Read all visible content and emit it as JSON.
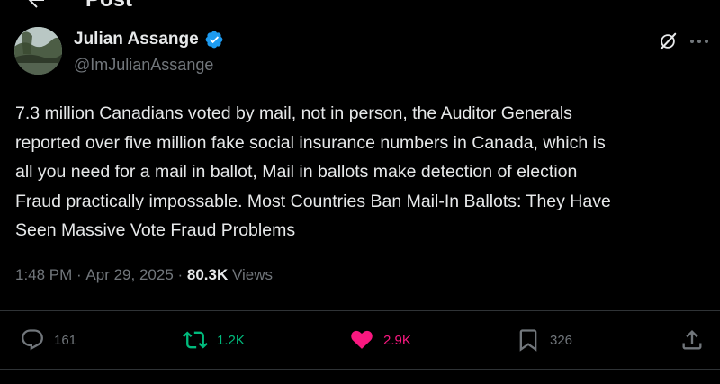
{
  "header": {
    "title": "Post",
    "back_icon": "back-arrow-icon"
  },
  "author": {
    "name": "Julian Assange",
    "handle": "@ImJulianAssange",
    "verified_icon": "verified-badge-icon",
    "verified_color": "#1d9bf0"
  },
  "tweet": {
    "text": "7.3 million Canadians voted by mail, not in person, the Auditor Generals\nreported over five million fake social insurance numbers in Canada, which is\nall you need for a mail in ballot, Mail in ballots make detection of election\nFraud practically impossable. Most Countries Ban Mail-In Ballots: They Have\nSeen Massive Vote Fraud Problems"
  },
  "meta": {
    "time": "1:48 PM",
    "separator": " · ",
    "date": "Apr 29, 2025",
    "views_count": "80.3K",
    "views_label": " Views"
  },
  "actions": {
    "replies": "161",
    "reposts": "1.2K",
    "likes": "2.9K",
    "bookmarks": "326"
  },
  "colors": {
    "background": "#000000",
    "text": "#e7e9ea",
    "secondary": "#71767b",
    "repost": "#00ba7c",
    "like": "#f91880"
  }
}
